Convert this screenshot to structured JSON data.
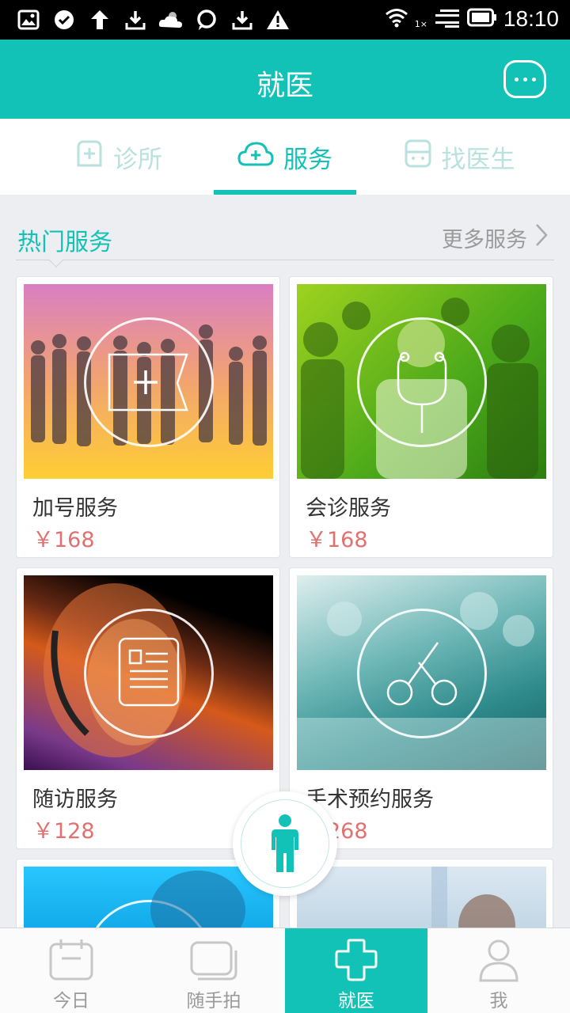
{
  "status_bar": {
    "time": "18:10",
    "network_label": "1×",
    "icons": [
      "image-icon",
      "check-circle-icon",
      "upload-icon",
      "download-icon",
      "cloud-icon",
      "chat-bubble-icon",
      "download-icon",
      "warning-icon",
      "wifi-icon",
      "signal-icon",
      "battery-icon"
    ]
  },
  "app_bar": {
    "title": "就医",
    "action_icon": "chat-icon"
  },
  "tabs": [
    {
      "label": "诊所",
      "icon": "plus-square-icon",
      "active": false
    },
    {
      "label": "服务",
      "icon": "cloud-plus-icon",
      "active": true
    },
    {
      "label": "找医生",
      "icon": "doctor-face-icon",
      "active": false
    }
  ],
  "section": {
    "title": "热门服务",
    "more_label": "更多服务"
  },
  "services": [
    {
      "title": "加号服务",
      "price": "￥168",
      "icon": "add-number-icon"
    },
    {
      "title": "会诊服务",
      "price": "￥168",
      "icon": "stethoscope-icon"
    },
    {
      "title": "随访服务",
      "price": "￥128",
      "icon": "document-icon"
    },
    {
      "title": "手术预约服务",
      "price": "￥268",
      "icon": "scissors-icon"
    }
  ],
  "bottom_nav": [
    {
      "label": "今日",
      "icon": "calendar-icon",
      "active": false
    },
    {
      "label": "随手拍",
      "icon": "photo-stack-icon",
      "active": false
    },
    {
      "label": "就医",
      "icon": "medical-cross-icon",
      "active": true
    },
    {
      "label": "我",
      "icon": "user-icon",
      "active": false
    }
  ],
  "colors": {
    "accent": "#13c2b6",
    "price": "#e2706f",
    "inactive_tab": "#b9e1de"
  }
}
